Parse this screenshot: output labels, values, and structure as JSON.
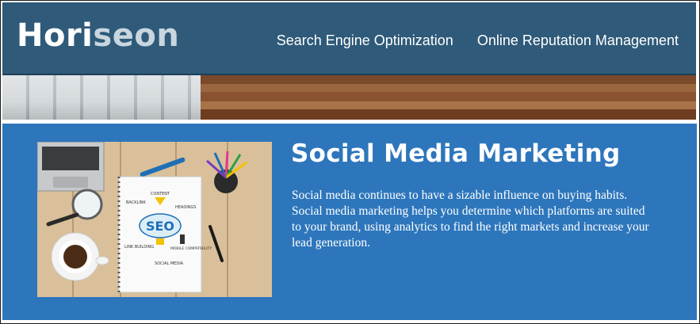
{
  "header": {
    "logo": {
      "part1": "Hori",
      "part2": "seon"
    },
    "nav": [
      {
        "label": "Search Engine Optimization"
      },
      {
        "label": "Online Reputation Management"
      }
    ],
    "colors": {
      "background": "#2f5a79",
      "logo_accent": "#c9d6df"
    }
  },
  "section": {
    "title": "Social Media Marketing",
    "description": "Social media continues to have a sizable influence on buying habits. Social media marketing helps you determine which platforms are suited to your brand, using analytics to find the right markets and increase your lead generation.",
    "background_color": "#2d76bc"
  },
  "illustration": {
    "notebook": {
      "center": "SEO",
      "labels": [
        "CONTENT",
        "BACKLINK",
        "HEADINGS",
        "LINK BUILDING",
        "MOBILE COMPATIBILITY",
        "SOCIAL MEDIA"
      ]
    }
  }
}
